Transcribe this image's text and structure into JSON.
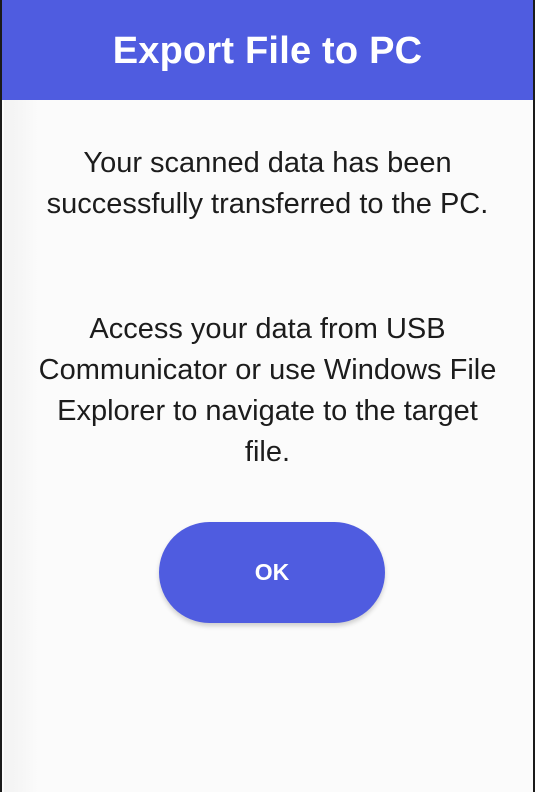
{
  "dialog": {
    "title": "Export File to PC",
    "message_primary": "Your scanned data has been successfully transferred to the PC.",
    "message_secondary": "Access your data from USB Communicator or use Windows File Explorer to navigate to the target file.",
    "ok_label": "OK"
  },
  "colors": {
    "accent": "#4f5ce0",
    "text": "#1c1c1c",
    "background": "#fbfbfb"
  }
}
